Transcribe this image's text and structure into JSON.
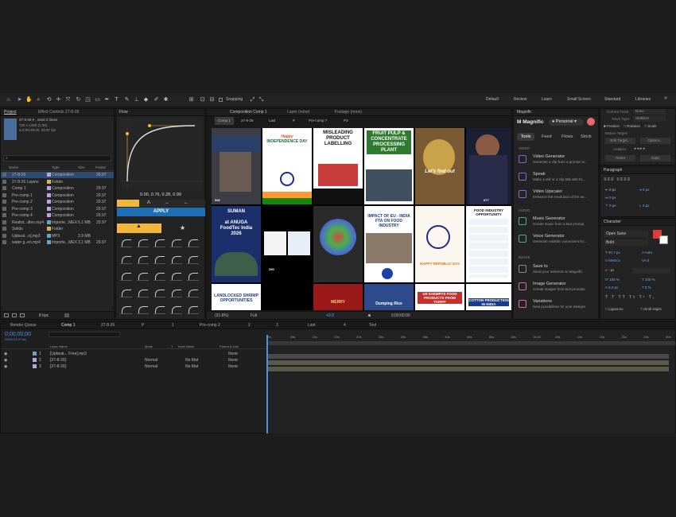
{
  "toolbar": {
    "snapping": "Snapping",
    "workspaces": [
      "Default",
      "Review",
      "Learn",
      "Small Screen",
      "Standard",
      "Libraries"
    ],
    "more": "»"
  },
  "project": {
    "tab": "Project",
    "effect_tab": "Effect Controls 27-8-26",
    "item_name": "27-8-26 ▾ , used 2 times",
    "item_dims": "730 x 1280 (1.00)",
    "item_dur": "Δ 0;00;29;29, 29.97 fps",
    "columns": [
      "Name",
      "Type",
      "Size",
      "Frame Ra..."
    ],
    "rows": [
      {
        "name": "27-8-26",
        "type": "Composition",
        "size": "",
        "fps": "29.97",
        "color": "#b9a5e0",
        "sel": true
      },
      {
        "name": "27-8-26 Layers",
        "type": "Folder",
        "size": "",
        "fps": "",
        "color": "#d9b557",
        "sel": false
      },
      {
        "name": "Comp 1",
        "type": "Composition",
        "size": "",
        "fps": "29.97",
        "color": "#b9a5e0",
        "sel": false
      },
      {
        "name": "Pre-comp 1",
        "type": "Composition",
        "size": "",
        "fps": "29.97",
        "color": "#b9a5e0",
        "sel": false
      },
      {
        "name": "Pre-comp 2",
        "type": "Composition",
        "size": "",
        "fps": "29.97",
        "color": "#b9a5e0",
        "sel": false
      },
      {
        "name": "Pre-comp 3",
        "type": "Composition",
        "size": "",
        "fps": "29.97",
        "color": "#b9a5e0",
        "sel": false
      },
      {
        "name": "Pre-comp 4",
        "type": "Composition",
        "size": "",
        "fps": "29.97",
        "color": "#b9a5e0",
        "sel": false
      },
      {
        "name": "Realist...dleo.mp4",
        "type": "Importe...MEX",
        "size": "6.1 MB",
        "fps": "29.97",
        "color": "#6aa5c9",
        "sel": false
      },
      {
        "name": "Solids",
        "type": "Folder",
        "size": "",
        "fps": "",
        "color": "#d9b557",
        "sel": false
      },
      {
        "name": "Upbeat...e].mp3",
        "type": "MP3",
        "size": "3.9 MB",
        "fps": "",
        "color": "#6aa5c9",
        "sel": false
      },
      {
        "name": "water g..en.mp4",
        "type": "Importe...MEX",
        "size": "3.1 MB",
        "fps": "29.97",
        "color": "#6aa5c9",
        "sel": false
      }
    ],
    "bpc": "8 bpc"
  },
  "flow": {
    "title": "Flow",
    "values": "0.00, 0.76, 0.28, 0.99",
    "apply": "APPLY"
  },
  "comp": {
    "tab_comp": "Composition Comp 1",
    "tab_layer": "Layer (none)",
    "tab_footage": "Footage (none)",
    "crumbs": [
      "Comp 1",
      "27-8-26",
      "Last",
      "P",
      "Pre-comp 7",
      "P3"
    ],
    "zoom": "(31.6%)",
    "res": "Full",
    "exposure": "+0.0",
    "time": "0;00;00;00"
  },
  "tiles": {
    "t1": "Happy",
    "t2": "INDEPENDENCE DAY",
    "t3": "MISLEADING PRODUCT LABELLING",
    "t4": "FRUIT PULP & CONCENTRATE PROCESSING PLANT",
    "t5": "Let's find out",
    "t6": "SUMAN",
    "t7": "at ANUGA FoodTec India 2026",
    "t8": "IMPACT OF EU - INDIA FTA ON FOOD INDUSTRY",
    "t9": "FOOD INDUSTRY OPPORTUNITY",
    "t10": "HAPPY REPUBLIC DAY",
    "t11": "LANDLOCKED SHRIMP OPPORTUNITIES",
    "t12": "Dumping Rice",
    "t13": "US EXEMPTS FOOD PRODUCTS FROM TARIFF",
    "t14": "COTTON PRODUCTION IN INDIA",
    "t15": "MERRY",
    "c1": "540",
    "c2": "677",
    "c3": "290"
  },
  "magnific": {
    "title": "Magnific",
    "brand": "Magnific",
    "plan": "Personal",
    "tabs": [
      "Tools",
      "Feed",
      "Flows",
      "Stock"
    ],
    "video_section": "VIDEO",
    "audio_section": "AUDIO",
    "image_section": "IMAGE",
    "tools": [
      {
        "name": "Video Generator",
        "desc": "Generate a clip from a prompt or..."
      },
      {
        "name": "Speak",
        "desc": "Make a still or a clip talk with th..."
      },
      {
        "name": "Video Upscaler",
        "desc": "Enhance the resolution of the se..."
      },
      {
        "name": "Music Generator",
        "desc": "Create music from a text prompt"
      },
      {
        "name": "Voice Generator",
        "desc": "Generate realistic voiceovers fro..."
      },
      {
        "name": "Save to",
        "desc": "Send your selection to Magnific"
      },
      {
        "name": "Image Generator",
        "desc": "Create images from text prompts"
      },
      {
        "name": "Variations",
        "desc": "New possibilities for your designs"
      }
    ]
  },
  "tracker": {
    "current_track": "Current Track:",
    "current_val": "None",
    "track_type": "Track Type:",
    "track_val": "Stabilize",
    "position": "Position",
    "rotation": "Rotation",
    "scale": "Scale",
    "motion_target": "Motion Target:",
    "edit_target": "Edit Target...",
    "options": "Options...",
    "analyze": "Analyze:",
    "reset": "Reset",
    "apply": "Apply"
  },
  "paragraph": {
    "title": "Paragraph",
    "v1": "0 px",
    "v2": "0 px",
    "v3": "0 px",
    "v4": "0 px",
    "v5": "0 px"
  },
  "character": {
    "title": "Character",
    "font": "Open Sans",
    "style": "Bold",
    "size": "30.7 px",
    "leading": "Auto",
    "kern": "Metrics",
    "track": "0",
    "stroke": "- px",
    "vscale": "100 %",
    "hscale": "100 %",
    "baseline": "0.2 px",
    "tsume": "0 %",
    "ligatures": "Ligatures",
    "hindi": "Hindi Digits"
  },
  "timeline": {
    "tabs": [
      "Render Queue",
      "Comp 1",
      "27-8-26",
      "P",
      "1",
      "Pre-comp 2",
      "2",
      "3",
      "Last",
      "4",
      "Text"
    ],
    "timecode": "0;00;00;00",
    "fps_small": "00000 (29.97 fps)",
    "columns": [
      "Layer Name",
      "Mode",
      "T",
      "Track Matte",
      "Parent & Link"
    ],
    "layers": [
      {
        "num": "1",
        "name": "[Upbeat... Free].mp3",
        "mode": "",
        "matte": "",
        "parent": "None"
      },
      {
        "num": "2",
        "name": "[27-8-26]",
        "mode": "Normal",
        "matte": "No Mat",
        "parent": "None"
      },
      {
        "num": "3",
        "name": "[27-8-26]",
        "mode": "Normal",
        "matte": "No Mat",
        "parent": "None"
      }
    ],
    "ruler": [
      "0s",
      "05s",
      "10s",
      "15s",
      "20s",
      "25s",
      "30s",
      "35s",
      "40s",
      "45s",
      "50s",
      "55s",
      "00:00",
      "05s",
      "10s",
      "15s",
      "20s",
      "25s",
      "30s"
    ]
  }
}
